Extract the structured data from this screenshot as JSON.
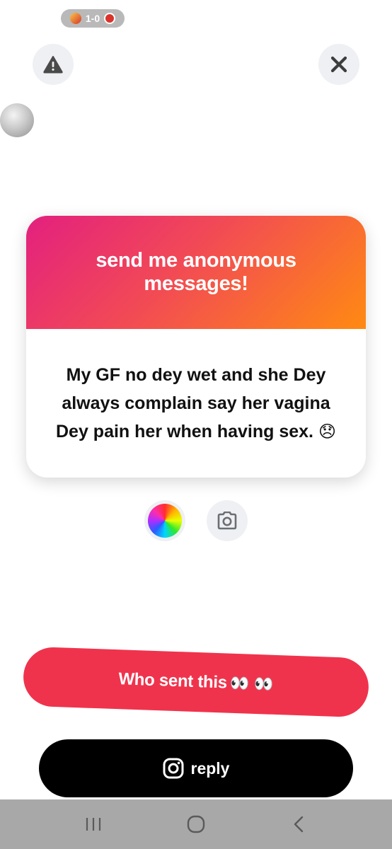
{
  "status": {
    "score": "1-0"
  },
  "card": {
    "title": "send me anonymous messages!",
    "message": "My GF no dey wet and she Dey always complain say her vagina Dey pain her when having sex.",
    "emoji": "😞"
  },
  "actions": {
    "who_sent_label": "Who sent this",
    "who_sent_emoji": "👀 👀",
    "reply_label": "reply"
  },
  "icons": {
    "report": "warning-icon",
    "close": "close-icon",
    "color": "color-wheel-icon",
    "camera": "camera-icon",
    "instagram": "instagram-icon",
    "nav_recents": "recents-icon",
    "nav_home": "home-icon",
    "nav_back": "back-icon"
  },
  "colors": {
    "gradient_start": "#e3207f",
    "gradient_end": "#ff8a12",
    "who_sent_bg": "#f0334c",
    "reply_bg": "#000000"
  }
}
